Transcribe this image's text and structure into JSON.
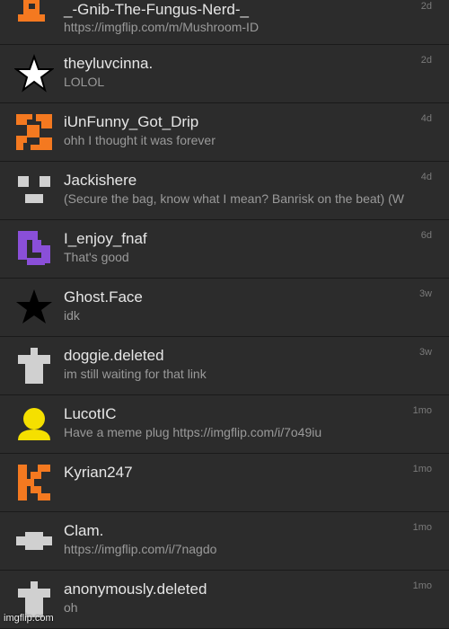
{
  "conversations": [
    {
      "username": "_-Gnib-The-Fungus-Nerd-_",
      "message": "https://imgflip.com/m/Mushroom-ID",
      "time": "2d",
      "avatar_icon": "orange-block-face-icon",
      "avatar_color": "#f47920"
    },
    {
      "username": "theyluvcinna.",
      "message": "LOLOL",
      "time": "2d",
      "avatar_icon": "white-star-icon",
      "avatar_color": "#ffffff"
    },
    {
      "username": "iUnFunny_Got_Drip",
      "message": "ohh I thought it was forever",
      "time": "4d",
      "avatar_icon": "orange-pixel-pattern-icon",
      "avatar_color": "#f47920"
    },
    {
      "username": "Jackishere",
      "message": "(Secure the bag, know what I mean? Banrisk on the beat) (W",
      "time": "4d",
      "avatar_icon": "gray-block-face-icon",
      "avatar_color": "#d0d0d0"
    },
    {
      "username": "I_enjoy_fnaf",
      "message": "That's good",
      "time": "6d",
      "avatar_icon": "purple-pixel-glyph-icon",
      "avatar_color": "#8a4fd8"
    },
    {
      "username": "Ghost.Face",
      "message": "idk",
      "time": "3w",
      "avatar_icon": "black-star-icon",
      "avatar_color": "#000000"
    },
    {
      "username": "doggie.deleted",
      "message": "im still waiting for that link",
      "time": "3w",
      "avatar_icon": "gray-shirt-icon",
      "avatar_color": "#d0d0d0"
    },
    {
      "username": "LucotIC",
      "message": "Have a meme plug https://imgflip.com/i/7o49iu",
      "time": "1mo",
      "avatar_icon": "yellow-person-icon",
      "avatar_color": "#f5e000"
    },
    {
      "username": "Kyrian247",
      "message": "",
      "time": "1mo",
      "avatar_icon": "orange-letter-k-icon",
      "avatar_color": "#f47920"
    },
    {
      "username": "Clam.",
      "message": "https://imgflip.com/i/7nagdo",
      "time": "1mo",
      "avatar_icon": "gray-fish-shape-icon",
      "avatar_color": "#d0d0d0"
    },
    {
      "username": "anonymously.deleted",
      "message": "oh",
      "time": "1mo",
      "avatar_icon": "gray-shirt-icon",
      "avatar_color": "#d0d0d0"
    }
  ],
  "watermark": "imgflip.com"
}
